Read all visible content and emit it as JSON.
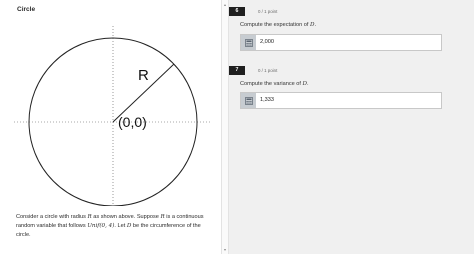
{
  "left": {
    "title": "Circle",
    "figure": {
      "radius_label": "R",
      "center_label": "(0,0)"
    },
    "caption": {
      "p1": "Consider a circle with radius ",
      "R1": "R",
      "p2": " as shown above. Suppose ",
      "R2": "R",
      "p3": " is a continuous random variable that follows ",
      "dist": "Unif(0, 4)",
      "p4": ". Let ",
      "D": "D",
      "p5": " be the circumference of the circle."
    }
  },
  "splitter": {
    "top_glyph": "▴",
    "bottom_glyph": "▾"
  },
  "questions": [
    {
      "number": "6",
      "points": "0 / 1 point",
      "text_before": "Compute the expectation of ",
      "var": "D",
      "text_after": ".",
      "answer": "2,000",
      "icon": "calculator-icon"
    },
    {
      "number": "7",
      "points": "0 / 1 point",
      "text_before": "Compute the variance of ",
      "var": "D",
      "text_after": ".",
      "answer": "1,333",
      "icon": "calculator-icon"
    }
  ],
  "colors": {
    "panel_bg": "#f0f0f0",
    "badge_bg": "#1f1f1f",
    "icon_bg": "#c7ccd1"
  }
}
